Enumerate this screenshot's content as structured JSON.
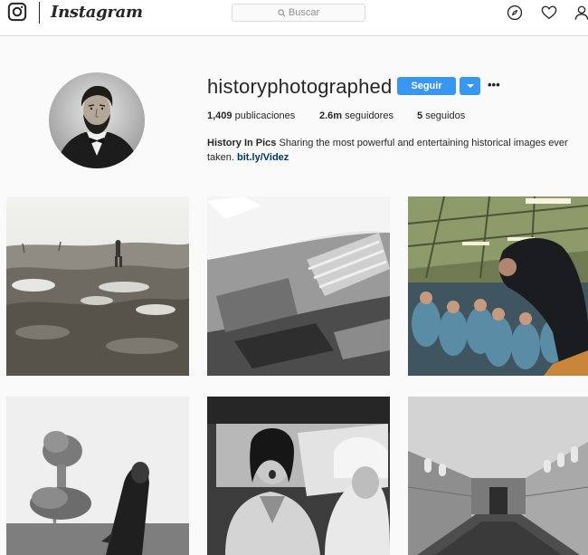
{
  "header": {
    "brand": "Instagram",
    "search_placeholder": "Buscar"
  },
  "icons": {
    "camera": "instagram-camera-icon",
    "search": "search-icon",
    "explore": "compass-icon",
    "activity": "heart-icon",
    "profile": "person-icon"
  },
  "profile": {
    "username": "historyphotographed",
    "follow_label": "Seguir",
    "more_label": "•••",
    "stats": {
      "posts_count": "1,409",
      "posts_label": "publicaciones",
      "followers_count": "2.6m",
      "followers_label": "seguidores",
      "following_count": "5",
      "following_label": "seguidos"
    },
    "bio": {
      "name": "History In Pics",
      "text": " Sharing the most powerful and entertaining historical images ever taken. ",
      "link": "bit.ly/Videz"
    }
  },
  "colors": {
    "accent": "#3897f0",
    "background": "#fafafa",
    "link": "#003569"
  }
}
